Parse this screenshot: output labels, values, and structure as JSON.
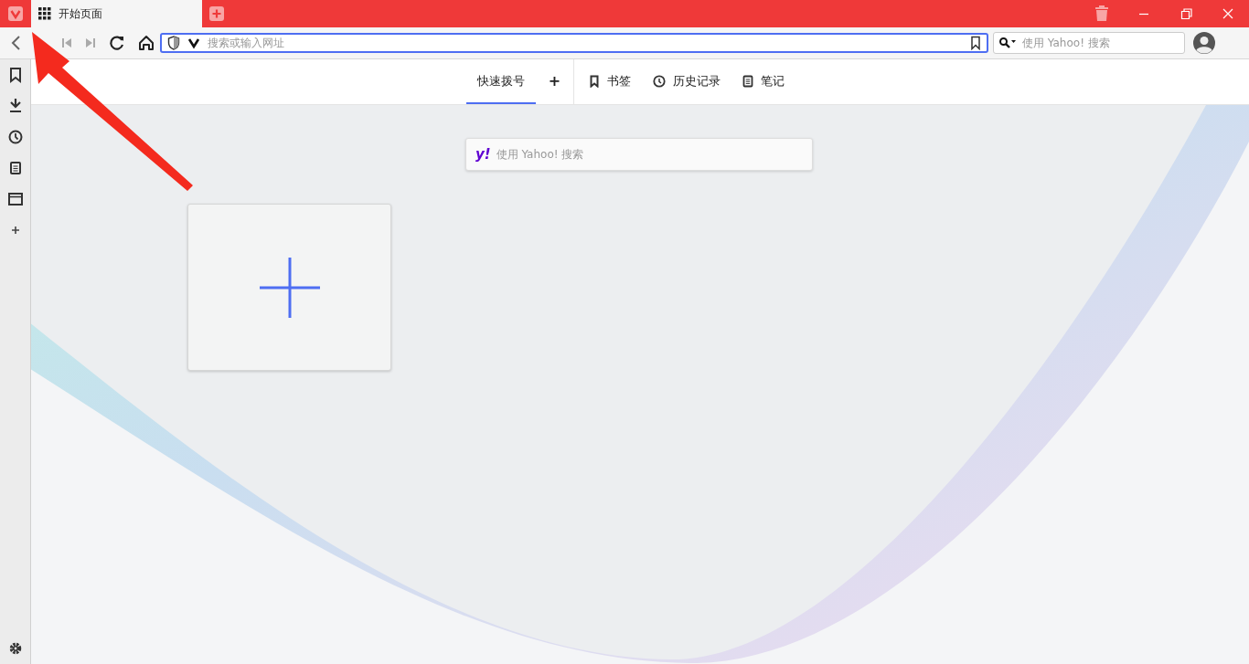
{
  "tab_bar": {
    "tabs": [
      {
        "title": "开始页面",
        "selected": true
      }
    ]
  },
  "address_bar": {
    "placeholder": "搜索或输入网址"
  },
  "search_field": {
    "placeholder": "使用 Yahoo! 搜索"
  },
  "panel_tabs": [
    {
      "kind": "tab",
      "label": "快速拨号",
      "selected": true
    },
    {
      "kind": "add",
      "label": "+",
      "selected": false
    },
    {
      "kind": "tab",
      "label": "书签",
      "selected": false
    },
    {
      "kind": "tab",
      "label": "历史记录",
      "selected": false
    },
    {
      "kind": "tab",
      "label": "笔记",
      "selected": false
    }
  ],
  "page_search": {
    "logo": "y!",
    "placeholder": "使用 Yahoo! 搜索"
  },
  "speed_dial": {
    "add_tile": true
  }
}
